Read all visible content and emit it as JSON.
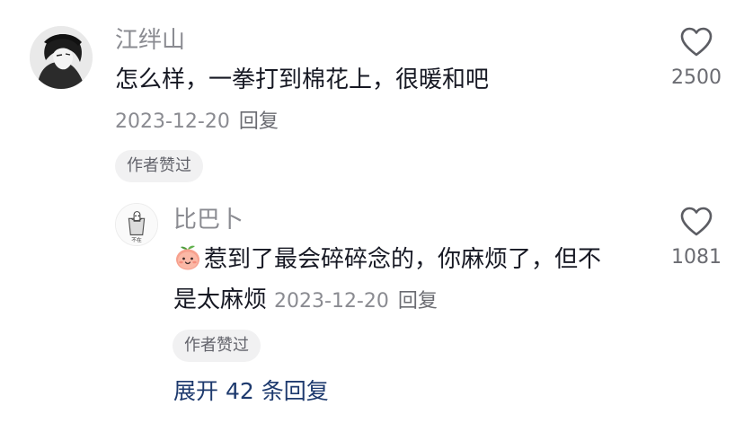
{
  "comment": {
    "username": "江绊山",
    "text": "怎么样，一拳打到棉花上，很暖和吧",
    "date": "2023-12-20",
    "reply_label": "回复",
    "badge": "作者赞过",
    "like_count": "2500"
  },
  "reply": {
    "username": "比巴卜",
    "text_line1": "惹到了最会碎碎念的，你麻烦了，但不",
    "text_line2": "是太麻烦",
    "date": "2023-12-20",
    "reply_label": "回复",
    "badge": "作者赞过",
    "like_count": "1081",
    "emoji": "smiling-peach-face"
  },
  "expand_label": "展开 42 条回复",
  "colors": {
    "username": "#8a8b91",
    "text": "#161823",
    "meta": "#8a8b91",
    "badge_bg": "#f1f1f2",
    "expand": "#1e3a6e"
  }
}
